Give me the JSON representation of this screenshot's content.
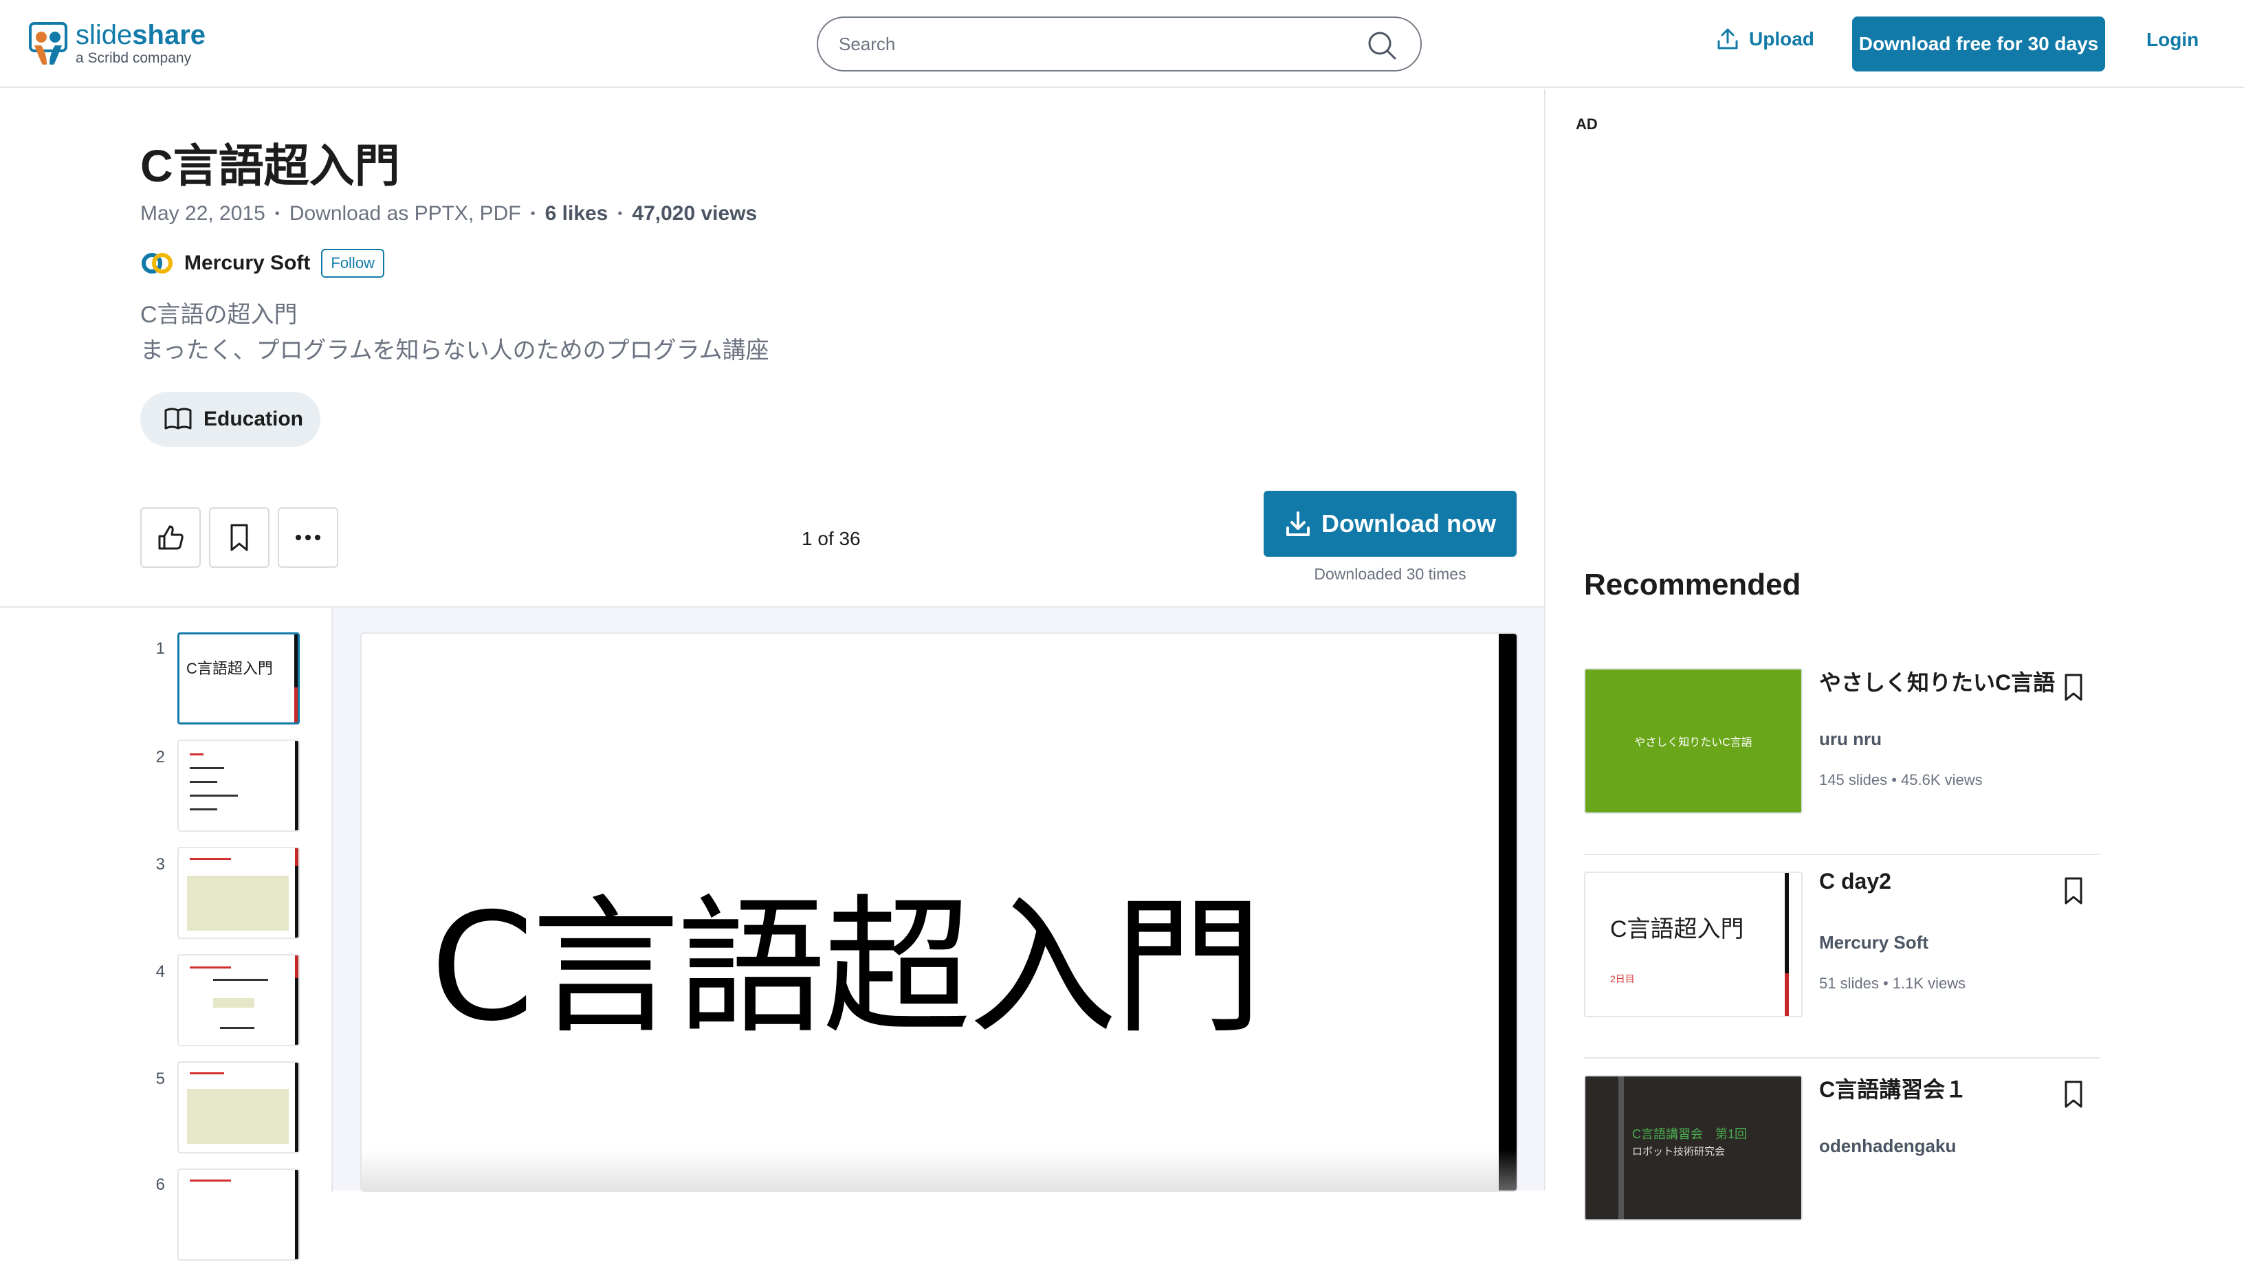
{
  "header": {
    "logo_name": "slideshare",
    "logo_sub": "a Scribd company",
    "search_placeholder": "Search",
    "upload_label": "Upload",
    "trial_button": "Download free for 30 days",
    "login_label": "Login"
  },
  "document": {
    "title": "C言語超入門",
    "date": "May 22, 2015",
    "download_as": "Download as PPTX, PDF",
    "likes": "6 likes",
    "views": "47,020 views",
    "author": "Mercury Soft",
    "follow_label": "Follow",
    "description_line1": "C言語の超入門",
    "description_line2": "まったく、プログラムを知らない人のためのプログラム講座",
    "category": "Education",
    "page_count": "1 of 36",
    "download_button": "Download now",
    "download_count": "Downloaded 30 times"
  },
  "thumbnails": [
    {
      "num": "1",
      "title": "C言語超入門"
    },
    {
      "num": "2"
    },
    {
      "num": "3"
    },
    {
      "num": "4"
    },
    {
      "num": "5"
    },
    {
      "num": "6"
    }
  ],
  "slide": {
    "title": "C言語超入門"
  },
  "sidebar": {
    "ad_label": "AD",
    "recommended_heading": "Recommended",
    "items": [
      {
        "title": "やさしく知りたいC言語",
        "thumb_text": "やさしく知りたいC言語",
        "author": "uru nru",
        "slides": "145 slides",
        "views": "45.6K views"
      },
      {
        "title": "C day2",
        "thumb_text": "C言語超入門",
        "thumb_sub": "2日目",
        "author": "Mercury Soft",
        "slides": "51 slides",
        "views": "1.1K views"
      },
      {
        "title": "C言語講習会１",
        "thumb_text": "C言語講習会　第1回",
        "thumb_sub": "ロボット技術研究会",
        "author": "odenhadengaku"
      }
    ]
  },
  "colors": {
    "brand": "#117aa8",
    "rec1_thumb": "#6aa61a",
    "rec3_thumb": "#2b2826"
  }
}
